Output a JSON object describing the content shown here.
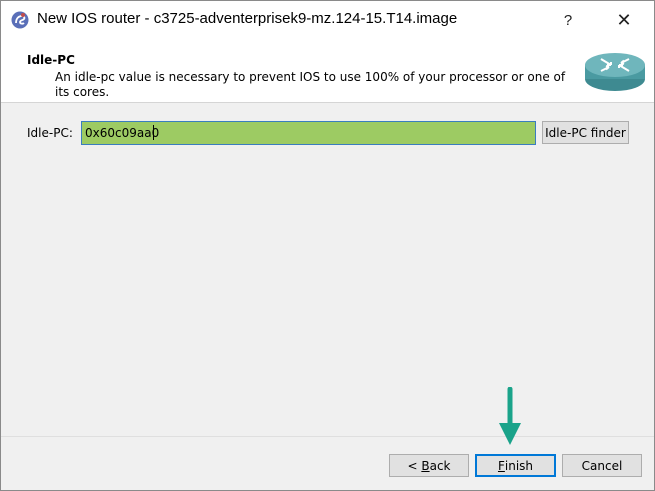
{
  "window": {
    "title": "New IOS router - c3725-adventerprisek9-mz.124-15.T14.image",
    "help_glyph": "?",
    "close_glyph": "✕"
  },
  "header": {
    "title": "Idle-PC",
    "subtitle": "An idle-pc value is necessary to prevent IOS to use 100% of your processor or one of its cores."
  },
  "form": {
    "idle_pc_label": "Idle-PC:",
    "idle_pc_value": "0x60c09aa0",
    "finder_label": "Idle-PC finder"
  },
  "footer": {
    "back_prefix": "< ",
    "back_accel": "B",
    "back_rest": "ack",
    "finish_accel": "F",
    "finish_rest": "inish",
    "cancel_label": "Cancel"
  },
  "colors": {
    "input_bg": "#9dcb63",
    "arrow": "#1aa38a",
    "focus_border": "#0078d7"
  },
  "icons": [
    "app-icon",
    "router-icon",
    "down-arrow-annotation"
  ]
}
